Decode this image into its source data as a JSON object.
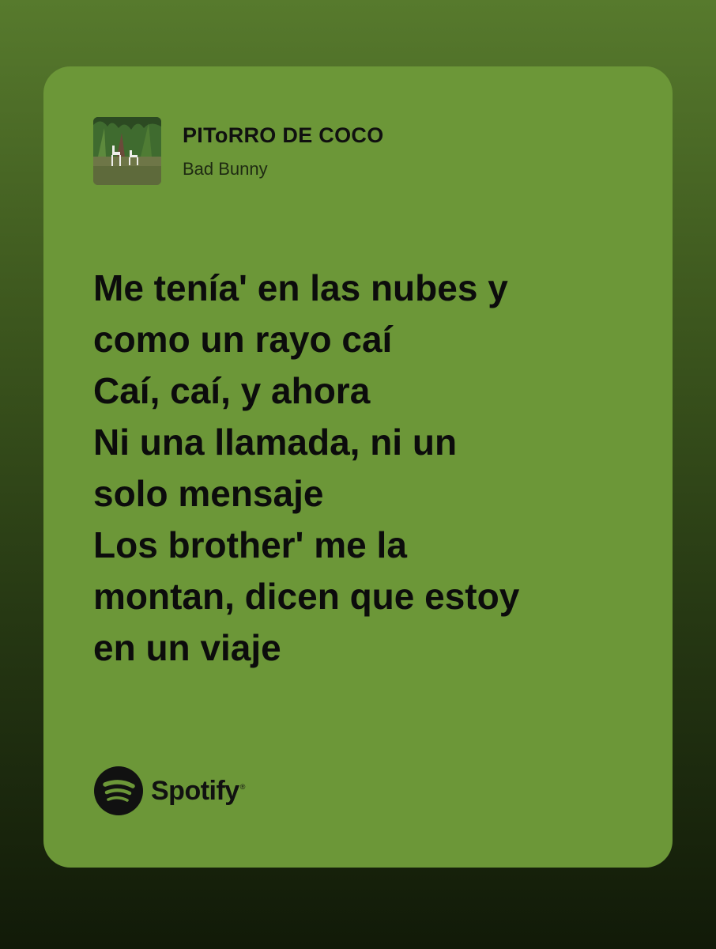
{
  "song": {
    "title": "PIToRRO DE COCO",
    "artist": "Bad Bunny",
    "artwork_icon": "album-art-chairs-in-garden"
  },
  "lyrics": [
    "Me tenía' en las nubes y",
    "como un rayo caí",
    "Caí, caí, y ahora",
    "Ni una llamada, ni un",
    "solo mensaje",
    "Los brother' me la",
    "montan, dicen que estoy",
    "en un viaje"
  ],
  "brand": {
    "name": "Spotify",
    "icon": "spotify-logo-icon"
  },
  "colors": {
    "card": "#6c9738",
    "text": "#0c0c0c"
  }
}
